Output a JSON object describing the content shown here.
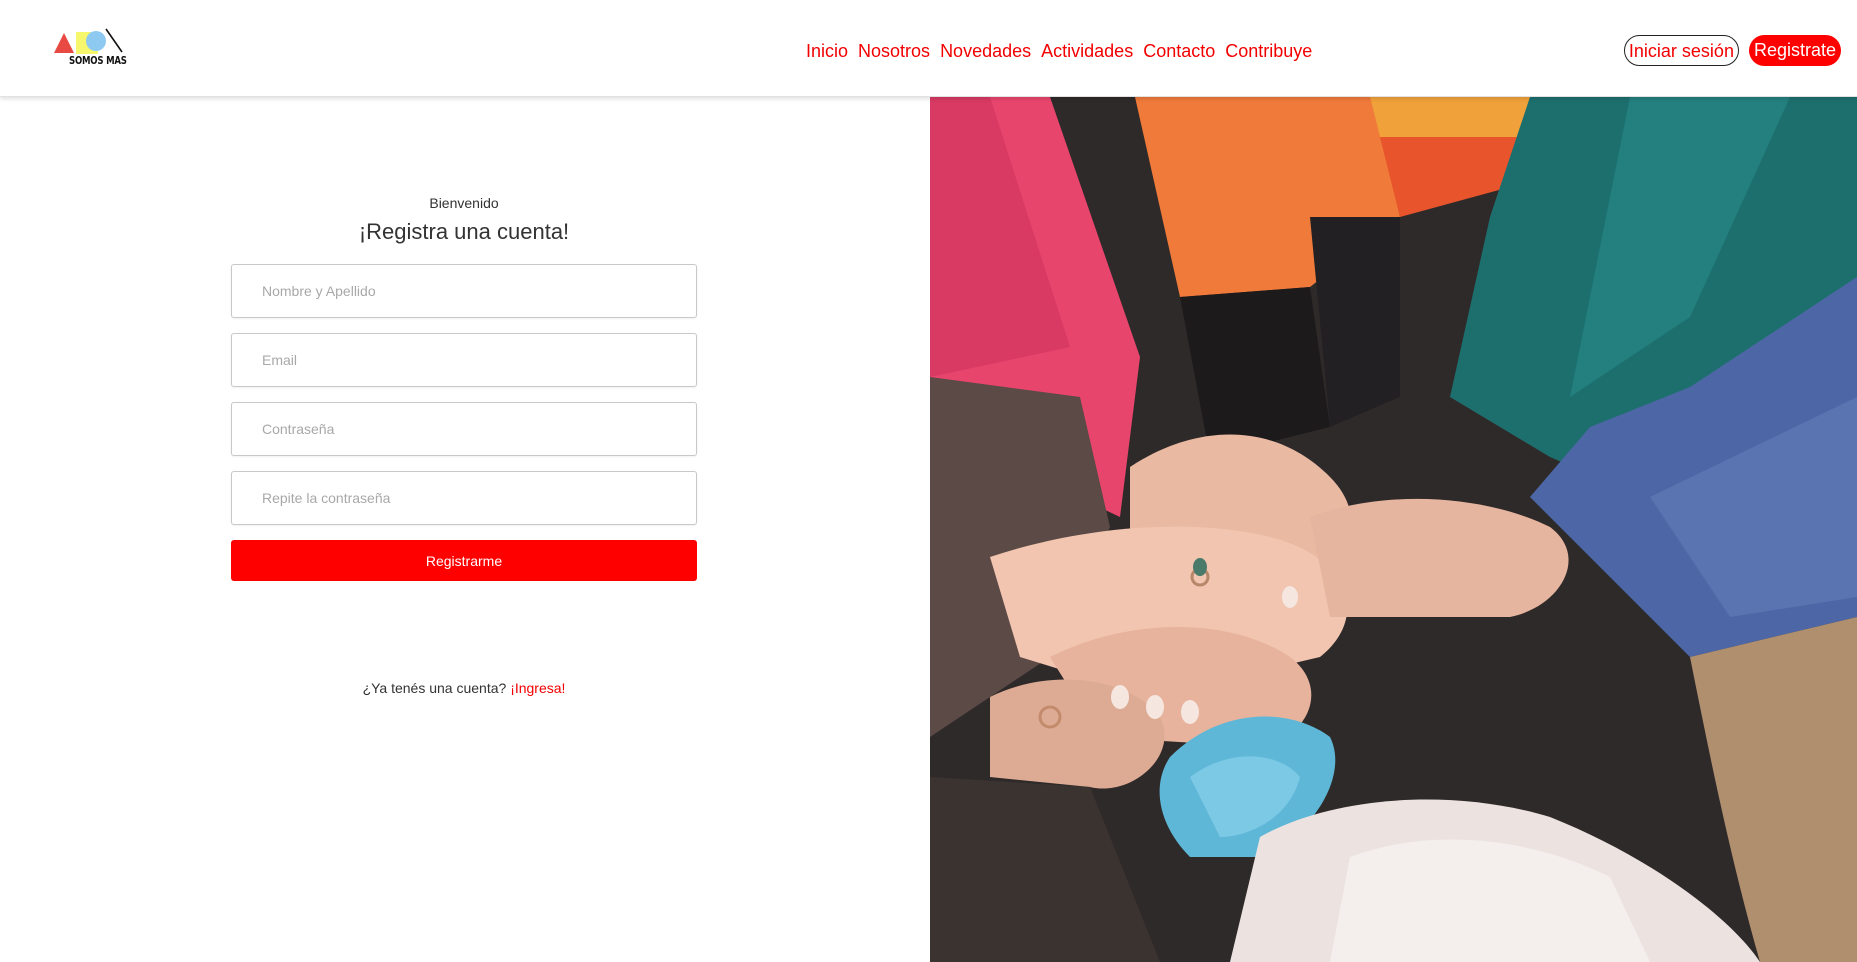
{
  "header": {
    "logo": {
      "text": "SOMOS MAS",
      "shape_colors": {
        "triangle": "#e84a43",
        "square": "#f7f76e",
        "circle": "#8ec9f2",
        "slash": "#111111"
      }
    },
    "nav": [
      {
        "label": "Inicio"
      },
      {
        "label": "Nosotros"
      },
      {
        "label": "Novedades"
      },
      {
        "label": "Actividades"
      },
      {
        "label": "Contacto"
      },
      {
        "label": "Contribuye"
      }
    ],
    "login_label": "Iniciar sesión",
    "register_label": "Registrate"
  },
  "form": {
    "welcome": "Bienvenido",
    "title": "¡Registra una cuenta!",
    "fields": {
      "name": {
        "placeholder": "Nombre y Apellido",
        "value": ""
      },
      "email": {
        "placeholder": "Email",
        "value": ""
      },
      "password": {
        "placeholder": "Contraseña",
        "value": ""
      },
      "repeat": {
        "placeholder": "Repite la contraseña",
        "value": ""
      }
    },
    "submit_label": "Registrarme",
    "login_prompt": "¿Ya tenés una cuenta?",
    "login_link": "¡Ingresa!"
  },
  "photo": {
    "subject": "stacked-hands-in-knit-sweaters"
  },
  "colors": {
    "accent": "#ff0000",
    "link": "#f20000",
    "text": "#333333",
    "placeholder": "#a8a8a8"
  }
}
